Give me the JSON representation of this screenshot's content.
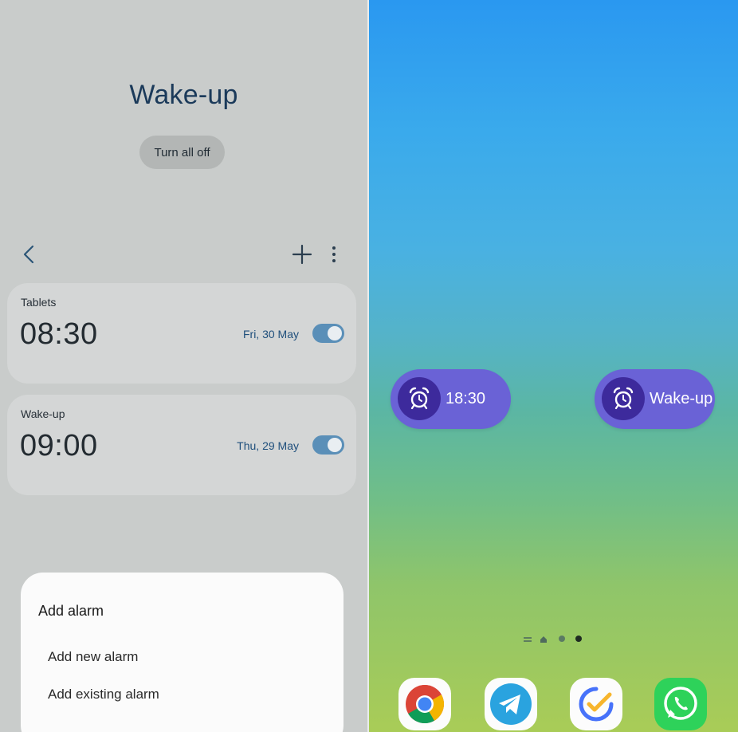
{
  "left_panel": {
    "group_title": "Wake-up",
    "turn_all_off_label": "Turn all off",
    "alarms": [
      {
        "label": "Tablets",
        "time": "08:30",
        "date": "Fri, 30 May",
        "enabled": true
      },
      {
        "label": "Wake-up",
        "time": "09:00",
        "date": "Thu, 29 May",
        "enabled": true
      }
    ],
    "sheet": {
      "title": "Add alarm",
      "items": [
        "Add new alarm",
        "Add existing alarm"
      ]
    }
  },
  "right_panel": {
    "widgets": [
      {
        "icon": "alarm-clock-icon",
        "text": "18:30"
      },
      {
        "icon": "alarm-clock-icon",
        "text": "Wake-up"
      }
    ],
    "page_indicator": {
      "pages": 3,
      "active_index": 2
    },
    "dock": [
      "chrome-icon",
      "telegram-icon",
      "ticktick-icon",
      "whatsapp-icon"
    ]
  },
  "colors": {
    "widget_bg": "#6a62d6",
    "widget_icon_bg": "#3d2a9c",
    "toggle_on": "#5a8fb8",
    "title_text": "#1b3a5a"
  }
}
